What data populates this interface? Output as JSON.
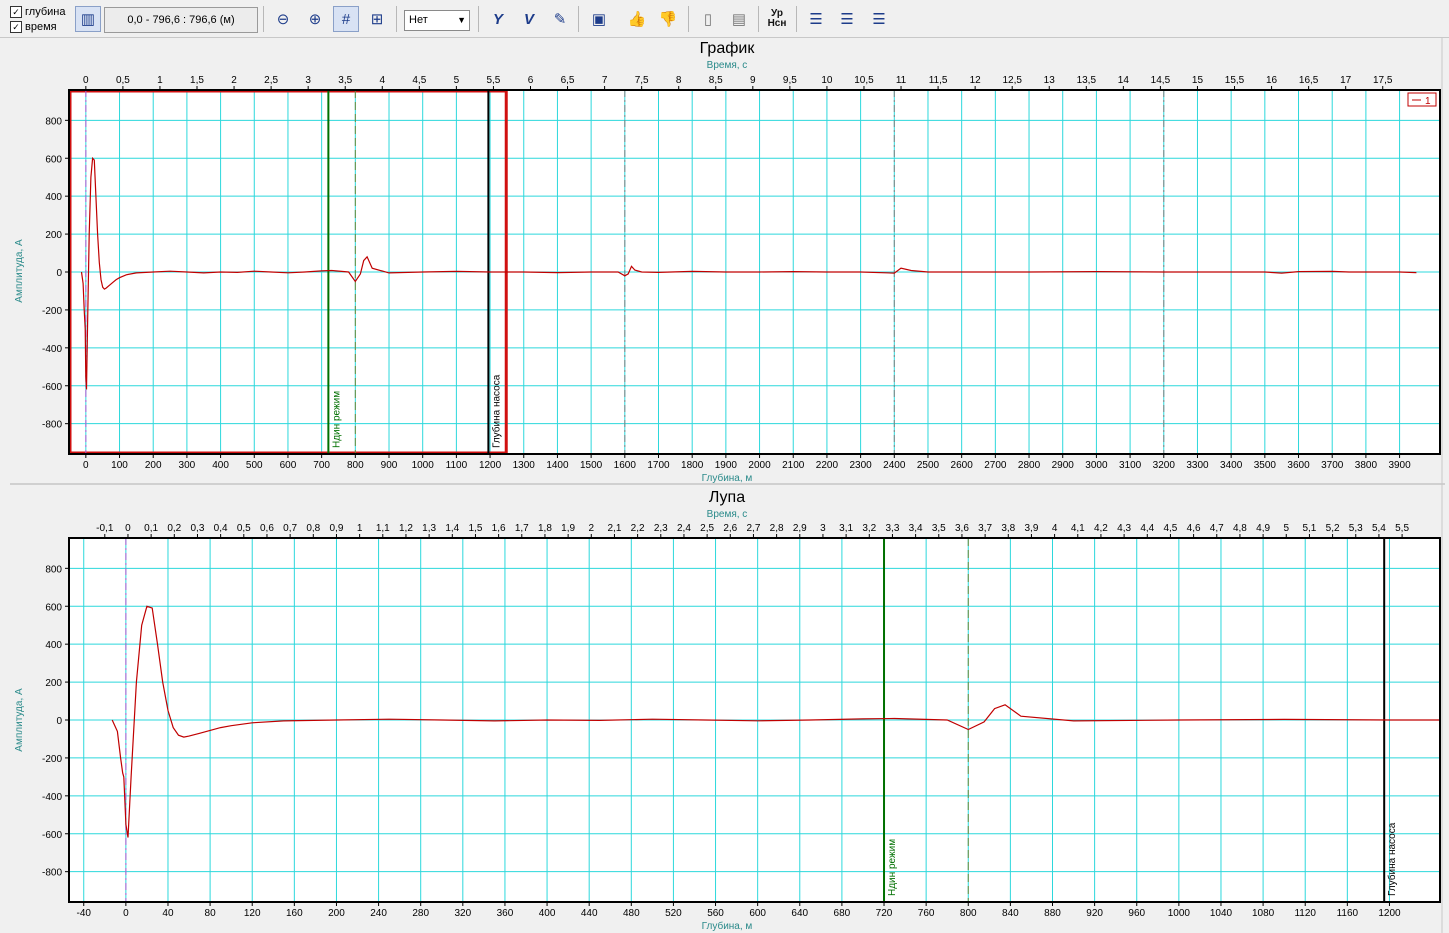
{
  "toolbar": {
    "depth_checkbox": "глубина",
    "time_checkbox": "время",
    "range_text": "0,0 - 796,6 : 796,6 (м)",
    "mode_select": "Нет",
    "ur_label_top": "Ур",
    "ur_label_bottom": "Нсн"
  },
  "chart_data": [
    {
      "type": "line",
      "title": "График",
      "xlabel": "Глубина, м",
      "x2label": "Время, с",
      "ylabel": "Амплитуда, А",
      "xlim": [
        -50,
        4020
      ],
      "ylim": [
        -960,
        960
      ],
      "x_ticks": [
        0,
        100,
        200,
        300,
        400,
        500,
        600,
        700,
        800,
        900,
        1000,
        1100,
        1200,
        1300,
        1400,
        1500,
        1600,
        1700,
        1800,
        1900,
        2000,
        2100,
        2200,
        2300,
        2400,
        2500,
        2600,
        2700,
        2800,
        2900,
        3000,
        3100,
        3200,
        3300,
        3400,
        3500,
        3600,
        3700,
        3800,
        3900
      ],
      "x2_ticks": [
        "0",
        "0,5",
        "1",
        "1,5",
        "2",
        "2,5",
        "3",
        "3,5",
        "4",
        "4,5",
        "5",
        "5,5",
        "6",
        "6,5",
        "7",
        "7,5",
        "8",
        "8,5",
        "9",
        "9,5",
        "10",
        "10,5",
        "11",
        "11,5",
        "12",
        "12,5",
        "13",
        "13,5",
        "14",
        "14,5",
        "15",
        "15,5",
        "16",
        "16,5",
        "17",
        "17,5"
      ],
      "y_ticks": [
        800,
        600,
        400,
        200,
        0,
        -200,
        -400,
        -600,
        -800
      ],
      "grid": true,
      "legend": {
        "position": "top-right",
        "entries": [
          "1"
        ]
      },
      "series": [
        {
          "name": "1",
          "color": "#c00000",
          "x": [
            -13,
            -8,
            -5,
            -2,
            0,
            2,
            5,
            10,
            15,
            20,
            25,
            30,
            35,
            40,
            45,
            50,
            55,
            60,
            70,
            80,
            90,
            100,
            120,
            150,
            200,
            250,
            300,
            350,
            400,
            450,
            500,
            550,
            600,
            650,
            700,
            730,
            780,
            800,
            815,
            825,
            835,
            850,
            900,
            1000,
            1100,
            1200,
            1300,
            1400,
            1500,
            1580,
            1600,
            1610,
            1620,
            1630,
            1650,
            1700,
            1800,
            1900,
            2000,
            2100,
            2200,
            2300,
            2400,
            2420,
            2450,
            2500,
            2600,
            2800,
            3000,
            3200,
            3400,
            3500,
            3550,
            3600,
            3700,
            3750,
            3800,
            3900,
            3950
          ],
          "y": [
            0,
            -60,
            -200,
            -300,
            -550,
            -620,
            -300,
            200,
            500,
            600,
            590,
            400,
            200,
            50,
            -40,
            -80,
            -90,
            -85,
            -70,
            -55,
            -40,
            -30,
            -15,
            -5,
            0,
            4,
            0,
            -5,
            0,
            -2,
            4,
            0,
            -4,
            0,
            6,
            8,
            0,
            -50,
            -10,
            60,
            80,
            20,
            -5,
            0,
            3,
            0,
            0,
            -3,
            0,
            0,
            -20,
            -10,
            30,
            10,
            0,
            -2,
            3,
            0,
            0,
            2,
            0,
            0,
            -6,
            20,
            8,
            0,
            0,
            0,
            2,
            0,
            0,
            0,
            -6,
            2,
            3,
            0,
            0,
            0,
            -3
          ]
        }
      ],
      "markers": [
        {
          "x": 0,
          "style": "dashdot",
          "color": "#b45ad2"
        },
        {
          "x": 720,
          "style": "solid",
          "color": "#007000",
          "label": "Ндин режим"
        },
        {
          "x": 800,
          "style": "dashed",
          "color": "#6a8a3a"
        },
        {
          "x": 1195,
          "style": "solid",
          "color": "#000000",
          "label": "Глубина насоса"
        },
        {
          "x": 1600,
          "style": "dashdot",
          "color": "#808080"
        },
        {
          "x": 2400,
          "style": "dashdot",
          "color": "#808080"
        },
        {
          "x": 3200,
          "style": "dashdot",
          "color": "#808080"
        }
      ],
      "zoom_window": [
        -50,
        1248
      ]
    },
    {
      "type": "line",
      "title": "Лупа",
      "xlabel": "Глубина, м",
      "x2label": "Время, с",
      "ylabel": "Амплитуда, А",
      "xlim": [
        -54,
        1248
      ],
      "ylim": [
        -960,
        960
      ],
      "x_ticks": [
        -40,
        0,
        40,
        80,
        120,
        160,
        200,
        240,
        280,
        320,
        360,
        400,
        440,
        480,
        520,
        560,
        600,
        640,
        680,
        720,
        760,
        800,
        840,
        880,
        920,
        960,
        1000,
        1040,
        1080,
        1120,
        1160,
        1200
      ],
      "x2_ticks": [
        "-0,1",
        "0",
        "0,1",
        "0,2",
        "0,3",
        "0,4",
        "0,5",
        "0,6",
        "0,7",
        "0,8",
        "0,9",
        "1",
        "1,1",
        "1,2",
        "1,3",
        "1,4",
        "1,5",
        "1,6",
        "1,7",
        "1,8",
        "1,9",
        "2",
        "2,1",
        "2,2",
        "2,3",
        "2,4",
        "2,5",
        "2,6",
        "2,7",
        "2,8",
        "2,9",
        "3",
        "3,1",
        "3,2",
        "3,3",
        "3,4",
        "3,5",
        "3,6",
        "3,7",
        "3,8",
        "3,9",
        "4",
        "4,1",
        "4,2",
        "4,3",
        "4,4",
        "4,5",
        "4,6",
        "4,7",
        "4,8",
        "4,9",
        "5",
        "5,1",
        "5,2",
        "5,3",
        "5,4",
        "5,5"
      ],
      "y_ticks": [
        800,
        600,
        400,
        200,
        0,
        -200,
        -400,
        -600,
        -800
      ],
      "grid": true,
      "series": [
        {
          "name": "1",
          "color": "#c00000",
          "x": [
            -13,
            -8,
            -5,
            -3,
            -2,
            0,
            2,
            5,
            10,
            15,
            20,
            25,
            30,
            35,
            40,
            45,
            50,
            55,
            60,
            70,
            80,
            90,
            100,
            120,
            150,
            200,
            250,
            300,
            350,
            400,
            450,
            500,
            550,
            600,
            650,
            700,
            730,
            780,
            800,
            815,
            825,
            835,
            850,
            900,
            1000,
            1100,
            1200,
            1248
          ],
          "y": [
            0,
            -60,
            -200,
            -280,
            -300,
            -550,
            -620,
            -300,
            200,
            500,
            600,
            590,
            400,
            200,
            50,
            -40,
            -80,
            -90,
            -85,
            -70,
            -55,
            -40,
            -30,
            -15,
            -5,
            0,
            4,
            0,
            -5,
            0,
            -2,
            4,
            0,
            -4,
            0,
            6,
            8,
            0,
            -50,
            -10,
            60,
            80,
            20,
            -5,
            0,
            3,
            0,
            0
          ]
        }
      ],
      "markers": [
        {
          "x": 0,
          "style": "dashdot",
          "color": "#b45ad2"
        },
        {
          "x": 720,
          "style": "solid",
          "color": "#007000",
          "label": "Ндин режим"
        },
        {
          "x": 800,
          "style": "dashed",
          "color": "#6a8a3a"
        },
        {
          "x": 1195,
          "style": "solid",
          "color": "#000000",
          "label": "Глубина насоса"
        }
      ]
    }
  ]
}
